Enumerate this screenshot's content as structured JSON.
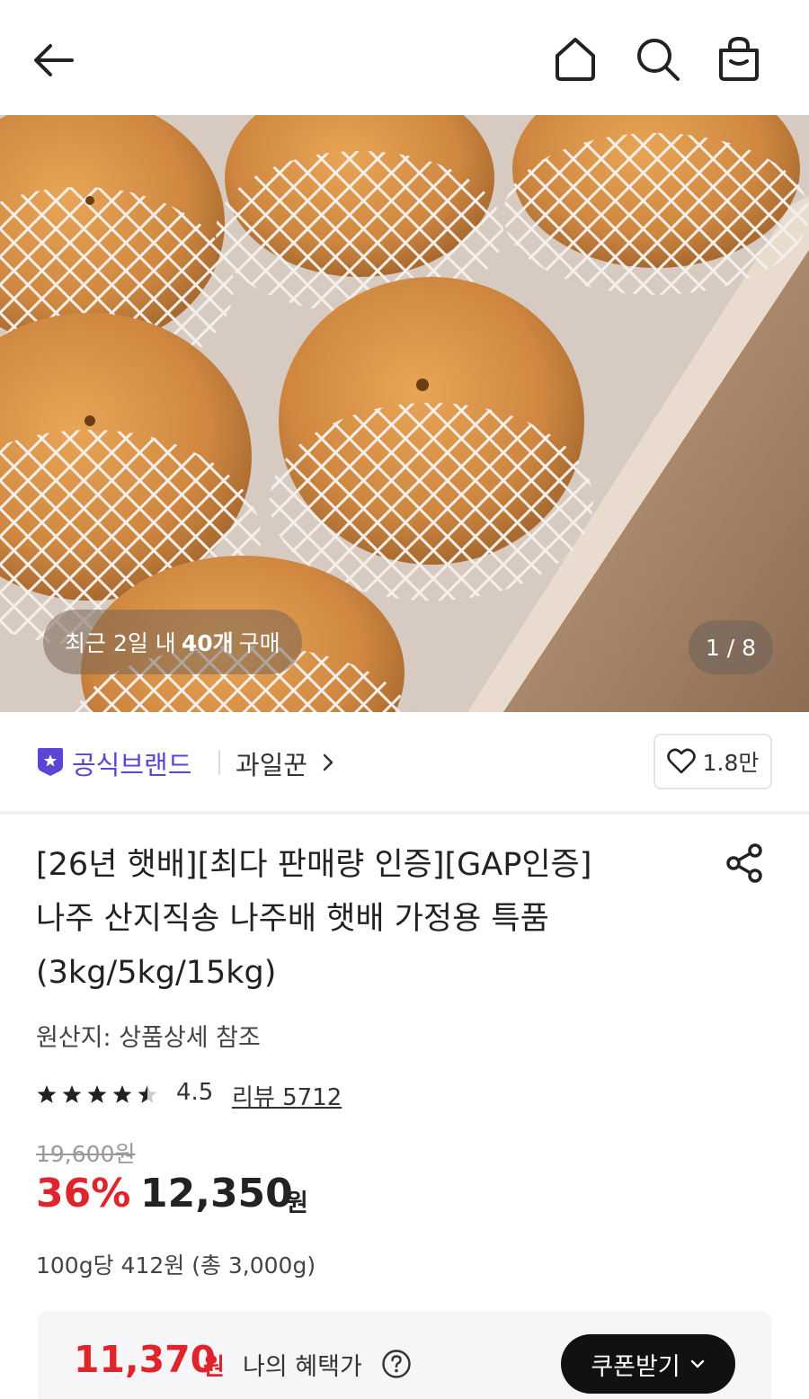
{
  "header": {
    "icons": [
      "back-arrow-icon",
      "home-icon",
      "search-icon",
      "shopping-bag-icon"
    ]
  },
  "hero": {
    "purchase_prefix": "최근 2일 내",
    "purchase_count": "40개",
    "purchase_suffix": "구매",
    "page_indicator": "1 / 8"
  },
  "brand": {
    "official_label": "공식브랜드",
    "seller_name": "과일꾼",
    "like_count": "1.8만",
    "accent_color": "#5a45d6"
  },
  "product": {
    "title_lines": [
      "[26년 햇배][최다 판매량 인증][GAP인증]",
      "나주 산지직송 나주배 햇배 가정용 특품",
      "(3kg/5kg/15kg)"
    ],
    "origin": "원산지: 상품상세 참조",
    "rating": "4.5",
    "rating_value": 4.5,
    "review_link": "리뷰 5712"
  },
  "pricing": {
    "original_price": "19,600원",
    "discount": "36%",
    "price": "12,350",
    "currency": "원",
    "unit_price": "100g당 412원 (총 3,000g)",
    "sale_color": "#e0242b"
  },
  "benefit": {
    "price": "11,370",
    "currency": "원",
    "label": "나의 혜택가",
    "coupon_button": "쿠폰받기"
  }
}
